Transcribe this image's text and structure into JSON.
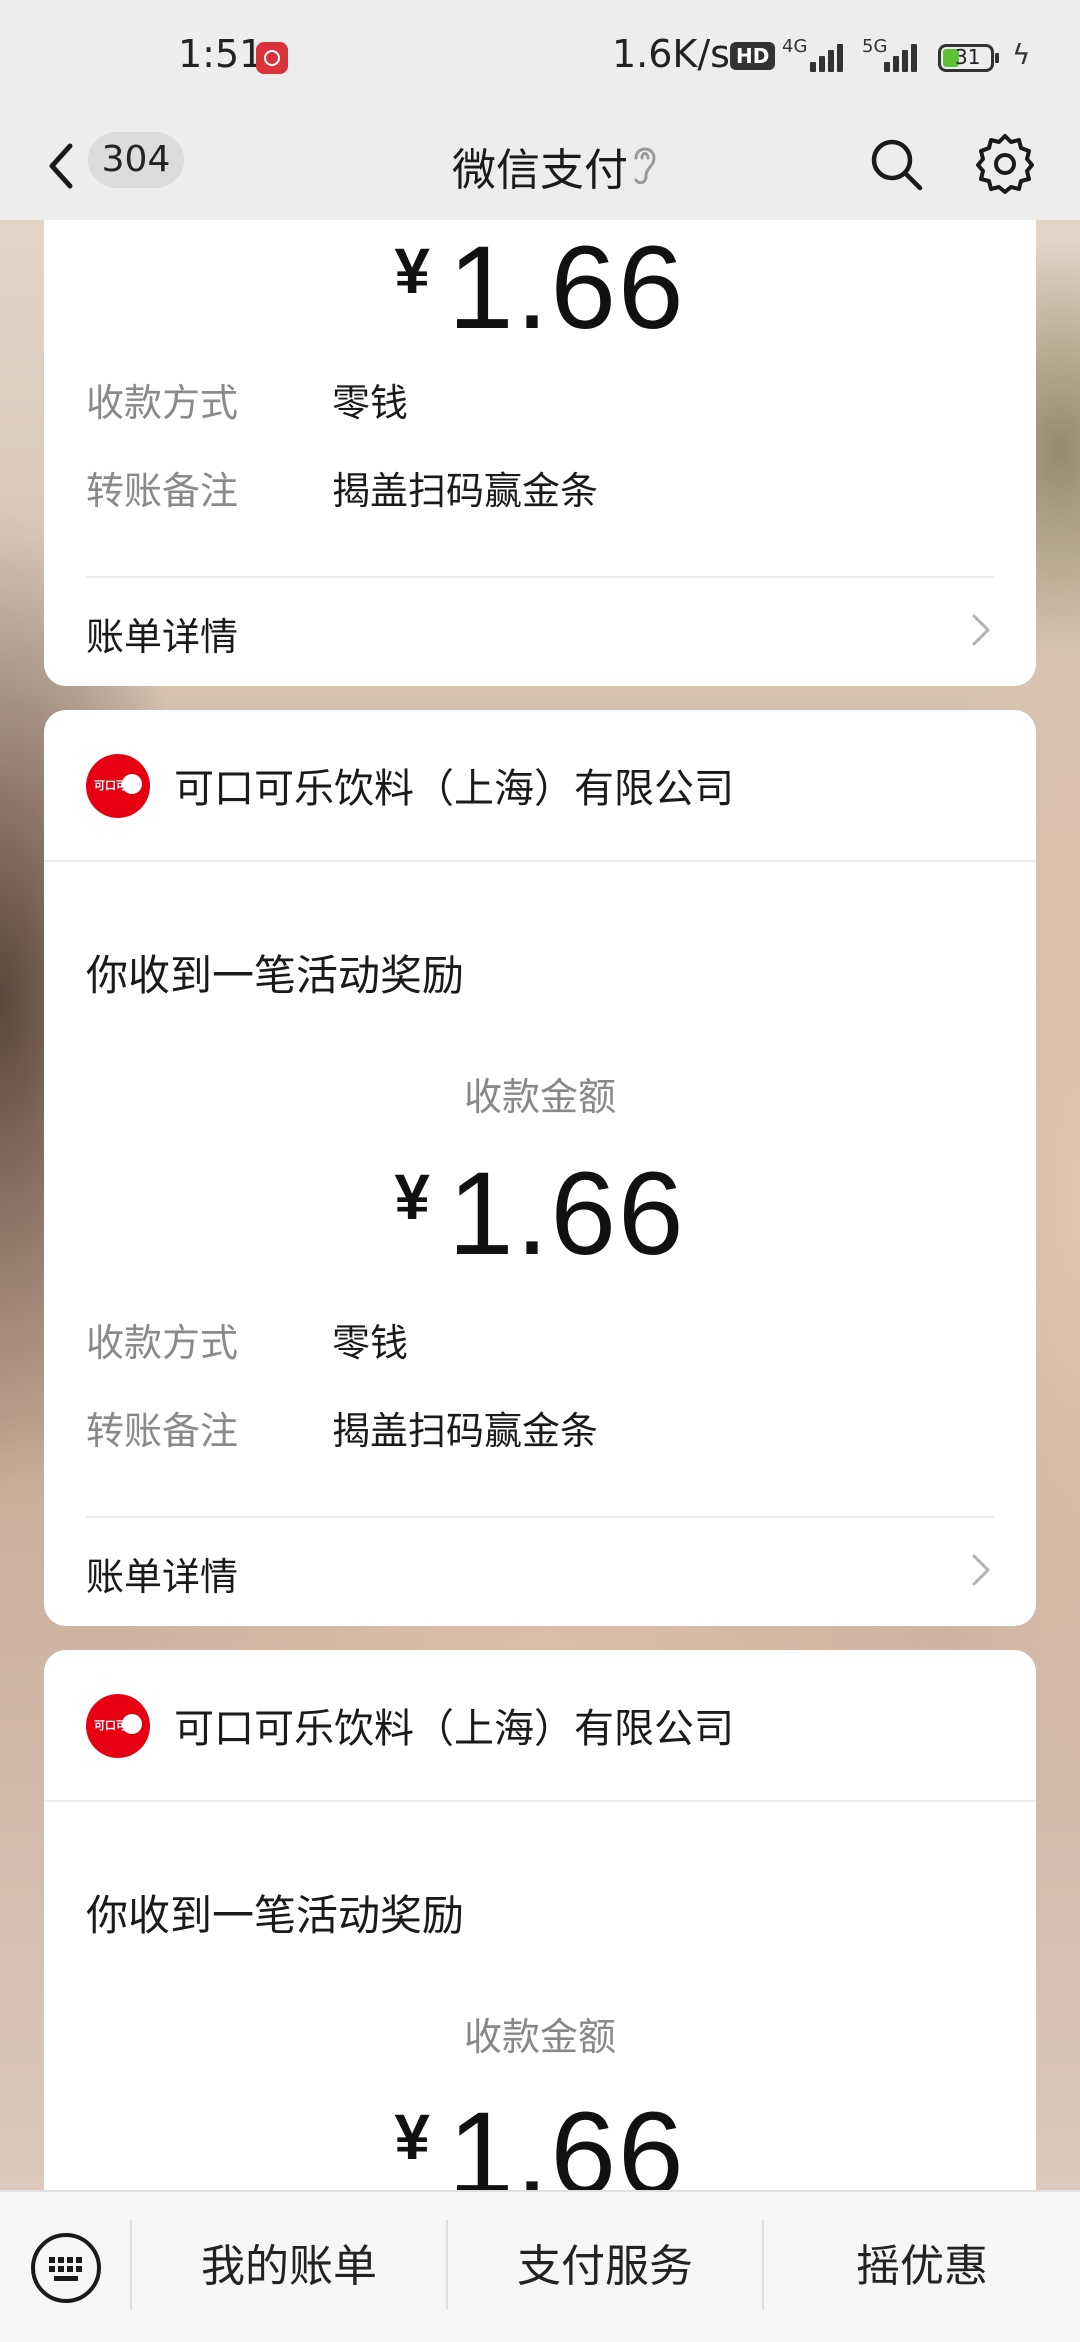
{
  "status": {
    "time": "1:51",
    "speed": "1.6K/s",
    "hd": "HD",
    "net1": "4G",
    "net2": "5G",
    "battery": "31"
  },
  "nav": {
    "unread": "304",
    "title": "微信支付"
  },
  "cards": [
    {
      "merchant": "",
      "notice": "",
      "amount_label": "",
      "currency": "¥",
      "amount": "1.66",
      "method_label": "收款方式",
      "method_value": "零钱",
      "memo_label": "转账备注",
      "memo_value": "揭盖扫码赢金条",
      "details_label": "账单详情"
    },
    {
      "merchant": "可口可乐饮料（上海）有限公司",
      "logo_text": "可口可乐",
      "notice": "你收到一笔活动奖励",
      "amount_label": "收款金额",
      "currency": "¥",
      "amount": "1.66",
      "method_label": "收款方式",
      "method_value": "零钱",
      "memo_label": "转账备注",
      "memo_value": "揭盖扫码赢金条",
      "details_label": "账单详情"
    },
    {
      "merchant": "可口可乐饮料（上海）有限公司",
      "logo_text": "可口可乐",
      "notice": "你收到一笔活动奖励",
      "amount_label": "收款金额",
      "currency": "¥",
      "amount": "1.66"
    }
  ],
  "bottom": {
    "items": [
      "我的账单",
      "支付服务",
      "摇优惠"
    ]
  },
  "colors": {
    "brand_red": "#e60012",
    "bar_bg": "#ededed"
  }
}
